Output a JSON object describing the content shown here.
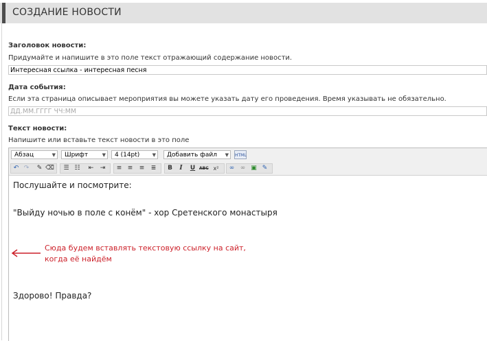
{
  "header": {
    "title": "СОЗДАНИЕ НОВОСТИ"
  },
  "title_field": {
    "label": "Заголовок новости:",
    "hint": "Придумайте и напишите в это поле текст отражающий содержание новости.",
    "value": "Интересная ссылка - интересная песня"
  },
  "date_field": {
    "label": "Дата события:",
    "hint": "Если эта страница описывает мероприятия вы можете указать дату его проведения. Время указывать не обязательно.",
    "placeholder": "ДД.ММ.ГГГГ ЧЧ:ММ"
  },
  "body_field": {
    "label": "Текст новости:",
    "hint": "Напишите или вставьте текст новости в это поле"
  },
  "toolbar": {
    "format_select": "Абзац",
    "font_select": "Шрифт",
    "size_select": "4 (14pt)",
    "file_select": "Добавить файл",
    "html_button": "HTML",
    "icons": [
      "undo-icon",
      "redo-icon",
      "cleanup-icon",
      "eraser-icon",
      "bullet-list-icon",
      "numbered-list-icon",
      "outdent-icon",
      "indent-icon",
      "align-left-icon",
      "align-center-icon",
      "align-right-icon",
      "align-justify-icon",
      "bold-icon",
      "italic-icon",
      "underline-icon",
      "strikethrough-icon",
      "superscript-icon",
      "link-icon",
      "unlink-icon",
      "image-icon",
      "edit-icon"
    ]
  },
  "editor_content": {
    "line1": "Послушайте и посмотрите:",
    "line2": "\"Выйду ночью в поле с конём\" - хор Сретенского монастыря",
    "line3": "Здорово! Правда?"
  },
  "annotation": {
    "line1": "Сюда будем вставлять текстовую ссылку на сайт,",
    "line2": "когда её найдём",
    "color": "#cc1f28"
  }
}
